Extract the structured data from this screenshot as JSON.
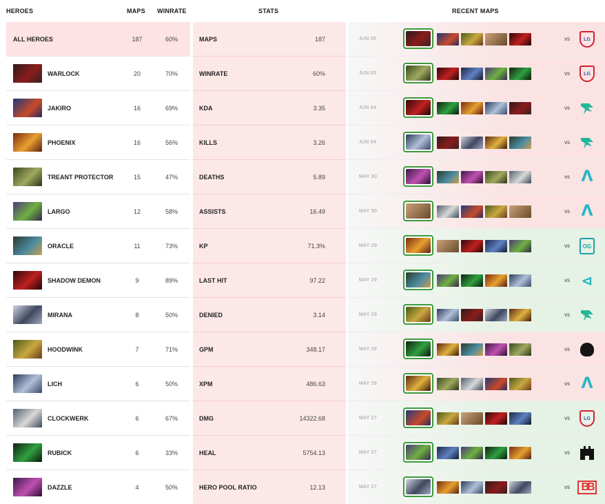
{
  "headers": {
    "heroes": "HEROES",
    "maps": "MAPS",
    "winrate": "WINRATE",
    "stats": "STATS",
    "recent_maps": "RECENT MAPS"
  },
  "heroes": [
    {
      "name": "ALL HEROES",
      "maps": "187",
      "winrate": "60%"
    },
    {
      "name": "WARLOCK",
      "maps": "20",
      "winrate": "70%"
    },
    {
      "name": "JAKIRO",
      "maps": "16",
      "winrate": "69%"
    },
    {
      "name": "PHOENIX",
      "maps": "16",
      "winrate": "56%"
    },
    {
      "name": "TREANT PROTECTOR",
      "maps": "15",
      "winrate": "47%"
    },
    {
      "name": "LARGO",
      "maps": "12",
      "winrate": "58%"
    },
    {
      "name": "ORACLE",
      "maps": "11",
      "winrate": "73%"
    },
    {
      "name": "SHADOW DEMON",
      "maps": "9",
      "winrate": "89%"
    },
    {
      "name": "MIRANA",
      "maps": "8",
      "winrate": "50%"
    },
    {
      "name": "HOODWINK",
      "maps": "7",
      "winrate": "71%"
    },
    {
      "name": "LICH",
      "maps": "6",
      "winrate": "50%"
    },
    {
      "name": "CLOCKWERK",
      "maps": "6",
      "winrate": "67%"
    },
    {
      "name": "RUBICK",
      "maps": "6",
      "winrate": "33%"
    },
    {
      "name": "DAZZLE",
      "maps": "4",
      "winrate": "50%"
    }
  ],
  "stats": [
    {
      "label": "MAPS",
      "value": "187"
    },
    {
      "label": "WINRATE",
      "value": "60%"
    },
    {
      "label": "KDA",
      "value": "3.35"
    },
    {
      "label": "KILLS",
      "value": "3.26"
    },
    {
      "label": "DEATHS",
      "value": "5.89"
    },
    {
      "label": "ASSISTS",
      "value": "16.49"
    },
    {
      "label": "KP",
      "value": "71.3%"
    },
    {
      "label": "LAST HIT",
      "value": "97.22"
    },
    {
      "label": "DENIED",
      "value": "3.14"
    },
    {
      "label": "GPM",
      "value": "348.17"
    },
    {
      "label": "XPM",
      "value": "486.63"
    },
    {
      "label": "DMG",
      "value": "14322.68"
    },
    {
      "label": "HEAL",
      "value": "5754.13"
    },
    {
      "label": "HERO POOL RATIO",
      "value": "12.13"
    }
  ],
  "recent_maps": [
    {
      "date": "JUN 05",
      "result": "loss",
      "vs": "vs",
      "opponent_logo": "lgd-logo"
    },
    {
      "date": "JUN 05",
      "result": "loss",
      "vs": "vs",
      "opponent_logo": "lgd-logo"
    },
    {
      "date": "JUN 04",
      "result": "loss",
      "vs": "vs",
      "opponent_logo": "falcons-logo"
    },
    {
      "date": "JUN 04",
      "result": "loss",
      "vs": "vs",
      "opponent_logo": "falcons-logo"
    },
    {
      "date": "MAY 30",
      "result": "loss",
      "vs": "vs",
      "opponent_logo": "aurora-logo"
    },
    {
      "date": "MAY 30",
      "result": "loss",
      "vs": "vs",
      "opponent_logo": "aurora-logo"
    },
    {
      "date": "MAY 29",
      "result": "win",
      "vs": "vs",
      "opponent_logo": "og-logo"
    },
    {
      "date": "MAY 29",
      "result": "win",
      "vs": "vs",
      "opponent_logo": "nigma-logo"
    },
    {
      "date": "MAY 29",
      "result": "win",
      "vs": "vs",
      "opponent_logo": "falcons-logo"
    },
    {
      "date": "MAY 28",
      "result": "loss",
      "vs": "vs",
      "opponent_logo": "spirit-logo"
    },
    {
      "date": "MAY 28",
      "result": "loss",
      "vs": "vs",
      "opponent_logo": "aurora-logo"
    },
    {
      "date": "MAY 27",
      "result": "win",
      "vs": "vs",
      "opponent_logo": "lgd-logo"
    },
    {
      "date": "MAY 27",
      "result": "win",
      "vs": "vs",
      "opponent_logo": "tundra-logo"
    },
    {
      "date": "MAY 27",
      "result": "win",
      "vs": "vs",
      "opponent_logo": "betboom-logo"
    }
  ],
  "colors": {
    "loss_bg": "#fbe3e3",
    "win_bg": "#e5f2e5",
    "stats_bg": "#fde8e8",
    "hero_border": "#3c9a3c"
  }
}
